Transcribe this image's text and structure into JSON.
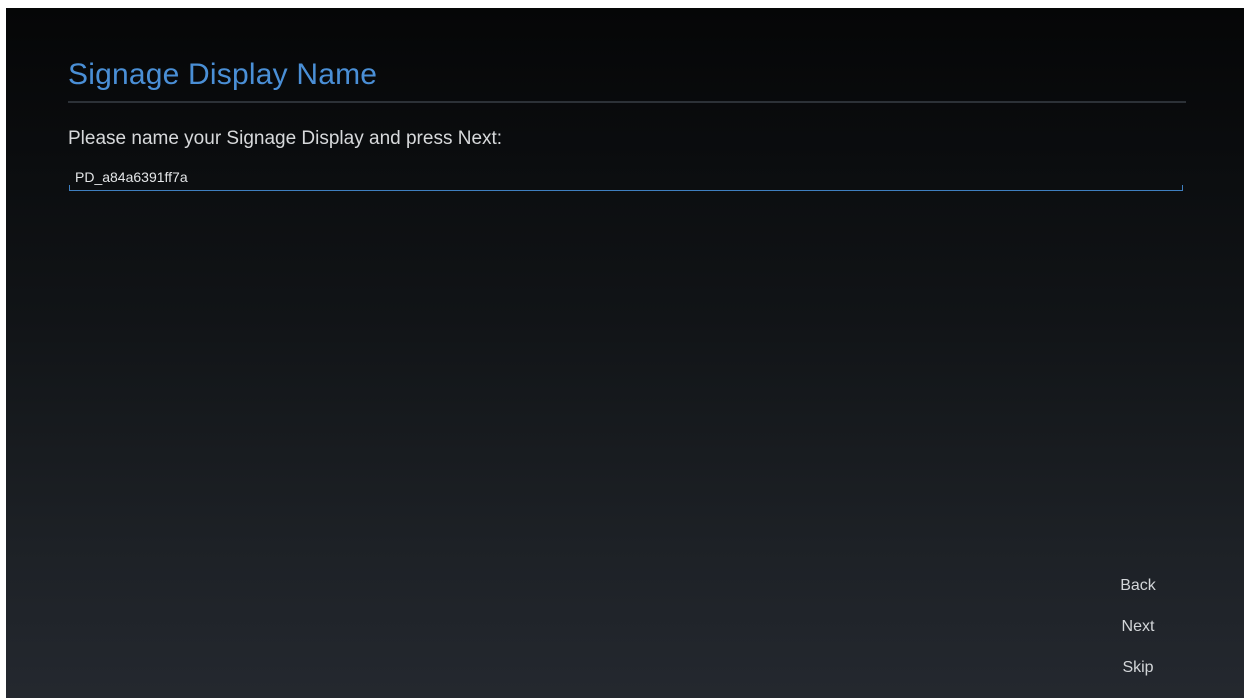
{
  "screen": {
    "title": "Signage Display Name",
    "prompt": "Please name your Signage Display and press Next:"
  },
  "name_input": {
    "value": "PD_a84a6391ff7a"
  },
  "nav": {
    "back_label": "Back",
    "next_label": "Next",
    "skip_label": "Skip"
  },
  "colors": {
    "title": "#4a8fd6",
    "input_underline": "#3f7fbf",
    "text": "#d7d9db"
  }
}
